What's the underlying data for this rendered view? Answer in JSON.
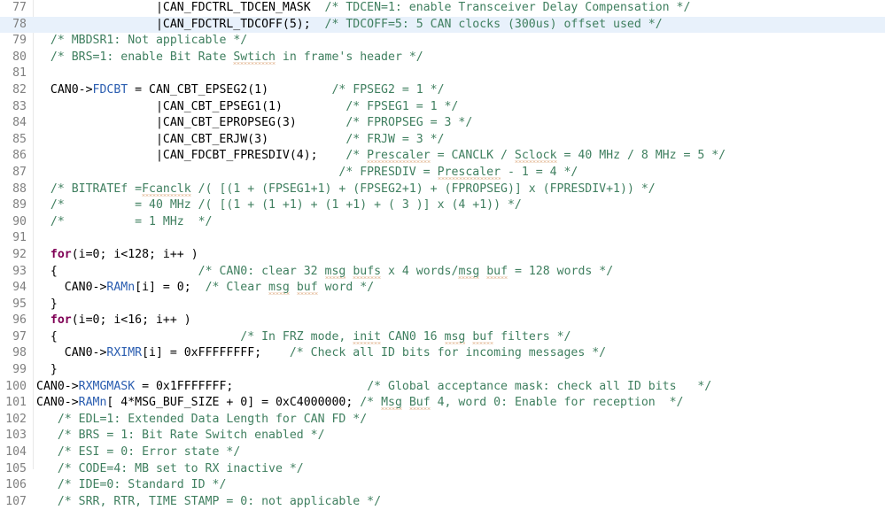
{
  "editor": {
    "language": "c",
    "first_line_number": 77,
    "current_line_number": 78,
    "colors": {
      "background": "#ffffff",
      "line_number": "#808080",
      "current_line_highlight": "#e8f1fb",
      "comment": "#3f7f5f",
      "keyword": "#7f0055",
      "member": "#2a5db0",
      "plain": "#000000",
      "spellcheck_underline": "#d4915d",
      "gutter_rule": "#e8e8e8"
    },
    "lines": [
      {
        "number": "77",
        "current": false,
        "tokens": [
          {
            "text": "                 |CAN_FDCTRL_TDCEN_MASK  ",
            "cls": "t-plain"
          },
          {
            "text": "/* TDCEN=1: enable Transceiver Delay Compensation */",
            "cls": "t-comment"
          }
        ]
      },
      {
        "number": "78",
        "current": true,
        "tokens": [
          {
            "text": "                 |CAN_FDCTRL_TDCOFF(5);  ",
            "cls": "t-plain"
          },
          {
            "text": "/* TDCOFF=5: 5 CAN clocks (300us) offset used */",
            "cls": "t-comment"
          }
        ]
      },
      {
        "number": "79",
        "current": false,
        "tokens": [
          {
            "text": "  ",
            "cls": "t-plain"
          },
          {
            "text": "/* MBDSR1: Not applicable */",
            "cls": "t-comment"
          }
        ]
      },
      {
        "number": "80",
        "current": false,
        "tokens": [
          {
            "text": "  ",
            "cls": "t-plain"
          },
          {
            "text": "/* BRS=1: enable Bit Rate ",
            "cls": "t-comment"
          },
          {
            "text": "Swtich",
            "cls": "t-comment sp"
          },
          {
            "text": " in frame's header */",
            "cls": "t-comment"
          }
        ]
      },
      {
        "number": "81",
        "current": false,
        "tokens": []
      },
      {
        "number": "82",
        "current": false,
        "tokens": [
          {
            "text": "  CAN0->",
            "cls": "t-plain"
          },
          {
            "text": "FDCBT",
            "cls": "t-member"
          },
          {
            "text": " = CAN_CBT_EPSEG2(1)         ",
            "cls": "t-plain"
          },
          {
            "text": "/* FPSEG2 = 1 */",
            "cls": "t-comment"
          }
        ]
      },
      {
        "number": "83",
        "current": false,
        "tokens": [
          {
            "text": "                 |CAN_CBT_EPSEG1(1)         ",
            "cls": "t-plain"
          },
          {
            "text": "/* FPSEG1 = 1 */",
            "cls": "t-comment"
          }
        ]
      },
      {
        "number": "84",
        "current": false,
        "tokens": [
          {
            "text": "                 |CAN_CBT_EPROPSEG(3)       ",
            "cls": "t-plain"
          },
          {
            "text": "/* FPROPSEG = 3 */",
            "cls": "t-comment"
          }
        ]
      },
      {
        "number": "85",
        "current": false,
        "tokens": [
          {
            "text": "                 |CAN_CBT_ERJW(3)           ",
            "cls": "t-plain"
          },
          {
            "text": "/* FRJW = 3 */",
            "cls": "t-comment"
          }
        ]
      },
      {
        "number": "86",
        "current": false,
        "tokens": [
          {
            "text": "                 |CAN_FDCBT_FPRESDIV(4);    ",
            "cls": "t-plain"
          },
          {
            "text": "/* ",
            "cls": "t-comment"
          },
          {
            "text": "Prescaler",
            "cls": "t-comment sp"
          },
          {
            "text": " = CANCLK / ",
            "cls": "t-comment"
          },
          {
            "text": "Sclock",
            "cls": "t-comment sp"
          },
          {
            "text": " = 40 MHz / 8 MHz = 5 */",
            "cls": "t-comment"
          }
        ]
      },
      {
        "number": "87",
        "current": false,
        "tokens": [
          {
            "text": "                                           ",
            "cls": "t-plain"
          },
          {
            "text": "/* FPRESDIV = ",
            "cls": "t-comment"
          },
          {
            "text": "Prescaler",
            "cls": "t-comment sp"
          },
          {
            "text": " - 1 = 4 */",
            "cls": "t-comment"
          }
        ]
      },
      {
        "number": "88",
        "current": false,
        "tokens": [
          {
            "text": "  ",
            "cls": "t-plain"
          },
          {
            "text": "/* BITRATEf =",
            "cls": "t-comment"
          },
          {
            "text": "Fcanclk",
            "cls": "t-comment sp"
          },
          {
            "text": " /( [(1 + (FPSEG1+1) + (FPSEG2+1) + (FPROPSEG)] x (FPRESDIV+1)) */",
            "cls": "t-comment"
          }
        ]
      },
      {
        "number": "89",
        "current": false,
        "tokens": [
          {
            "text": "  ",
            "cls": "t-plain"
          },
          {
            "text": "/*          = 40 MHz /( [(1 + (1 +1) + (1 +1) + ( 3 )] x (4 +1)) */",
            "cls": "t-comment"
          }
        ]
      },
      {
        "number": "90",
        "current": false,
        "tokens": [
          {
            "text": "  ",
            "cls": "t-plain"
          },
          {
            "text": "/*          = 1 MHz  */",
            "cls": "t-comment"
          }
        ]
      },
      {
        "number": "91",
        "current": false,
        "tokens": []
      },
      {
        "number": "92",
        "current": false,
        "tokens": [
          {
            "text": "  ",
            "cls": "t-plain"
          },
          {
            "text": "for",
            "cls": "t-kw"
          },
          {
            "text": "(i=0; i<128; i++ )",
            "cls": "t-plain"
          }
        ]
      },
      {
        "number": "93",
        "current": false,
        "tokens": [
          {
            "text": "  {                    ",
            "cls": "t-plain"
          },
          {
            "text": "/* CAN0: clear 32 ",
            "cls": "t-comment"
          },
          {
            "text": "msg",
            "cls": "t-comment sp"
          },
          {
            "text": " ",
            "cls": "t-comment"
          },
          {
            "text": "bufs",
            "cls": "t-comment sp"
          },
          {
            "text": " x 4 words/",
            "cls": "t-comment"
          },
          {
            "text": "msg",
            "cls": "t-comment sp"
          },
          {
            "text": " ",
            "cls": "t-comment"
          },
          {
            "text": "buf",
            "cls": "t-comment sp"
          },
          {
            "text": " = 128 words */",
            "cls": "t-comment"
          }
        ]
      },
      {
        "number": "94",
        "current": false,
        "tokens": [
          {
            "text": "    CAN0->",
            "cls": "t-plain"
          },
          {
            "text": "RAMn",
            "cls": "t-member"
          },
          {
            "text": "[i] = 0;  ",
            "cls": "t-plain"
          },
          {
            "text": "/* Clear ",
            "cls": "t-comment"
          },
          {
            "text": "msg",
            "cls": "t-comment sp"
          },
          {
            "text": " ",
            "cls": "t-comment"
          },
          {
            "text": "buf",
            "cls": "t-comment sp"
          },
          {
            "text": " word */",
            "cls": "t-comment"
          }
        ]
      },
      {
        "number": "95",
        "current": false,
        "tokens": [
          {
            "text": "  }",
            "cls": "t-plain"
          }
        ]
      },
      {
        "number": "96",
        "current": false,
        "tokens": [
          {
            "text": "  ",
            "cls": "t-plain"
          },
          {
            "text": "for",
            "cls": "t-kw"
          },
          {
            "text": "(i=0; i<16; i++ )",
            "cls": "t-plain"
          }
        ]
      },
      {
        "number": "97",
        "current": false,
        "tokens": [
          {
            "text": "  {                          ",
            "cls": "t-plain"
          },
          {
            "text": "/* In FRZ mode, ",
            "cls": "t-comment"
          },
          {
            "text": "init",
            "cls": "t-comment sp"
          },
          {
            "text": " CAN0 16 ",
            "cls": "t-comment"
          },
          {
            "text": "msg",
            "cls": "t-comment sp"
          },
          {
            "text": " ",
            "cls": "t-comment"
          },
          {
            "text": "buf",
            "cls": "t-comment sp"
          },
          {
            "text": " filters */",
            "cls": "t-comment"
          }
        ]
      },
      {
        "number": "98",
        "current": false,
        "tokens": [
          {
            "text": "    CAN0->",
            "cls": "t-plain"
          },
          {
            "text": "RXIMR",
            "cls": "t-member"
          },
          {
            "text": "[i] = 0xFFFFFFFF;    ",
            "cls": "t-plain"
          },
          {
            "text": "/* Check all ID bits for incoming messages */",
            "cls": "t-comment"
          }
        ]
      },
      {
        "number": "99",
        "current": false,
        "tokens": [
          {
            "text": "  }",
            "cls": "t-plain"
          }
        ]
      },
      {
        "number": "100",
        "current": false,
        "tokens": [
          {
            "text": "CAN0->",
            "cls": "t-plain"
          },
          {
            "text": "RXMGMASK",
            "cls": "t-member"
          },
          {
            "text": " = 0x1FFFFFFF;                   ",
            "cls": "t-plain"
          },
          {
            "text": "/* Global acceptance mask: check all ID bits   */",
            "cls": "t-comment"
          }
        ]
      },
      {
        "number": "101",
        "current": false,
        "tokens": [
          {
            "text": "CAN0->",
            "cls": "t-plain"
          },
          {
            "text": "RAMn",
            "cls": "t-member"
          },
          {
            "text": "[ 4*MSG_BUF_SIZE + 0] = 0xC4000000; ",
            "cls": "t-plain"
          },
          {
            "text": "/* ",
            "cls": "t-comment"
          },
          {
            "text": "Msg",
            "cls": "t-comment sp"
          },
          {
            "text": " ",
            "cls": "t-comment"
          },
          {
            "text": "Buf",
            "cls": "t-comment sp"
          },
          {
            "text": " 4, word 0: Enable for reception  */",
            "cls": "t-comment"
          }
        ]
      },
      {
        "number": "102",
        "current": false,
        "tokens": [
          {
            "text": "   ",
            "cls": "t-plain"
          },
          {
            "text": "/* EDL=1: Extended Data Length for CAN FD */",
            "cls": "t-comment"
          }
        ]
      },
      {
        "number": "103",
        "current": false,
        "tokens": [
          {
            "text": "   ",
            "cls": "t-plain"
          },
          {
            "text": "/* BRS = 1: Bit Rate Switch enabled */",
            "cls": "t-comment"
          }
        ]
      },
      {
        "number": "104",
        "current": false,
        "tokens": [
          {
            "text": "   ",
            "cls": "t-plain"
          },
          {
            "text": "/* ESI = 0: Error state */",
            "cls": "t-comment"
          }
        ]
      },
      {
        "number": "105",
        "current": false,
        "tokens": [
          {
            "text": "   ",
            "cls": "t-plain"
          },
          {
            "text": "/* CODE=4: MB set to RX inactive */",
            "cls": "t-comment"
          }
        ]
      },
      {
        "number": "106",
        "current": false,
        "tokens": [
          {
            "text": "   ",
            "cls": "t-plain"
          },
          {
            "text": "/* IDE=0: Standard ID */",
            "cls": "t-comment"
          }
        ]
      },
      {
        "number": "107",
        "current": false,
        "tokens": [
          {
            "text": "   ",
            "cls": "t-plain"
          },
          {
            "text": "/* SRR, RTR, TIME STAMP = 0: not applicable */",
            "cls": "t-comment"
          }
        ]
      }
    ]
  }
}
